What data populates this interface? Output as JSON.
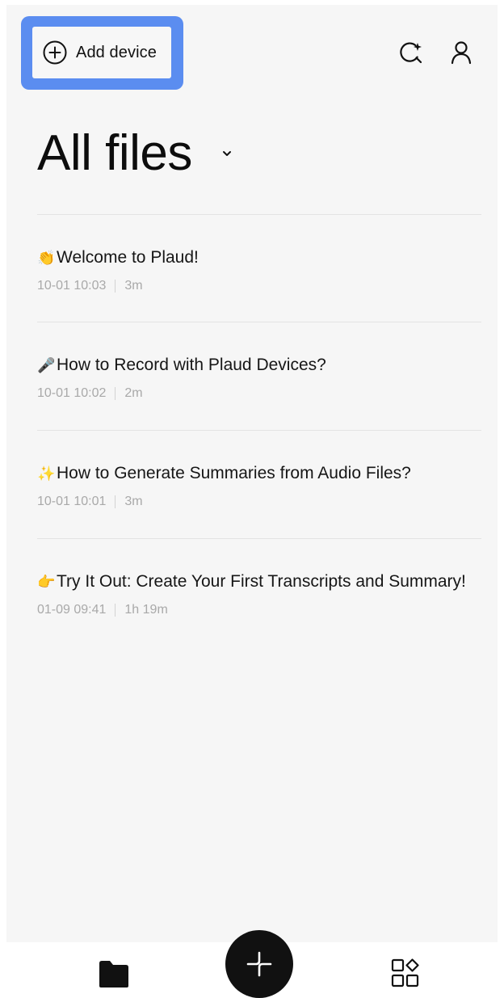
{
  "header": {
    "add_device_label": "Add device",
    "icons": [
      "plus-circle-icon",
      "ai-search-icon",
      "profile-icon"
    ],
    "highlight_color": "#5b8df0"
  },
  "main": {
    "title": "All files",
    "files": [
      {
        "emoji": "👏",
        "icon": "clapping-hands-icon",
        "title": "Welcome to Plaud!",
        "date": "10-01 10:03",
        "duration": "3m"
      },
      {
        "emoji": "🎤",
        "icon": "microphone-icon",
        "title": "How to Record with Plaud Devices?",
        "date": "10-01 10:02",
        "duration": "2m"
      },
      {
        "emoji": "✨",
        "icon": "sparkles-icon",
        "title": "How to Generate Summaries from Audio Files?",
        "date": "10-01 10:01",
        "duration": "3m"
      },
      {
        "emoji": "👉",
        "icon": "pointing-hand-icon",
        "title": "Try It Out: Create Your First Transcripts and Summary!",
        "date": "01-09 09:41",
        "duration": "1h 19m"
      }
    ]
  },
  "bottom_nav": {
    "icons": [
      "folder-icon",
      "record-icon",
      "apps-icon"
    ]
  }
}
